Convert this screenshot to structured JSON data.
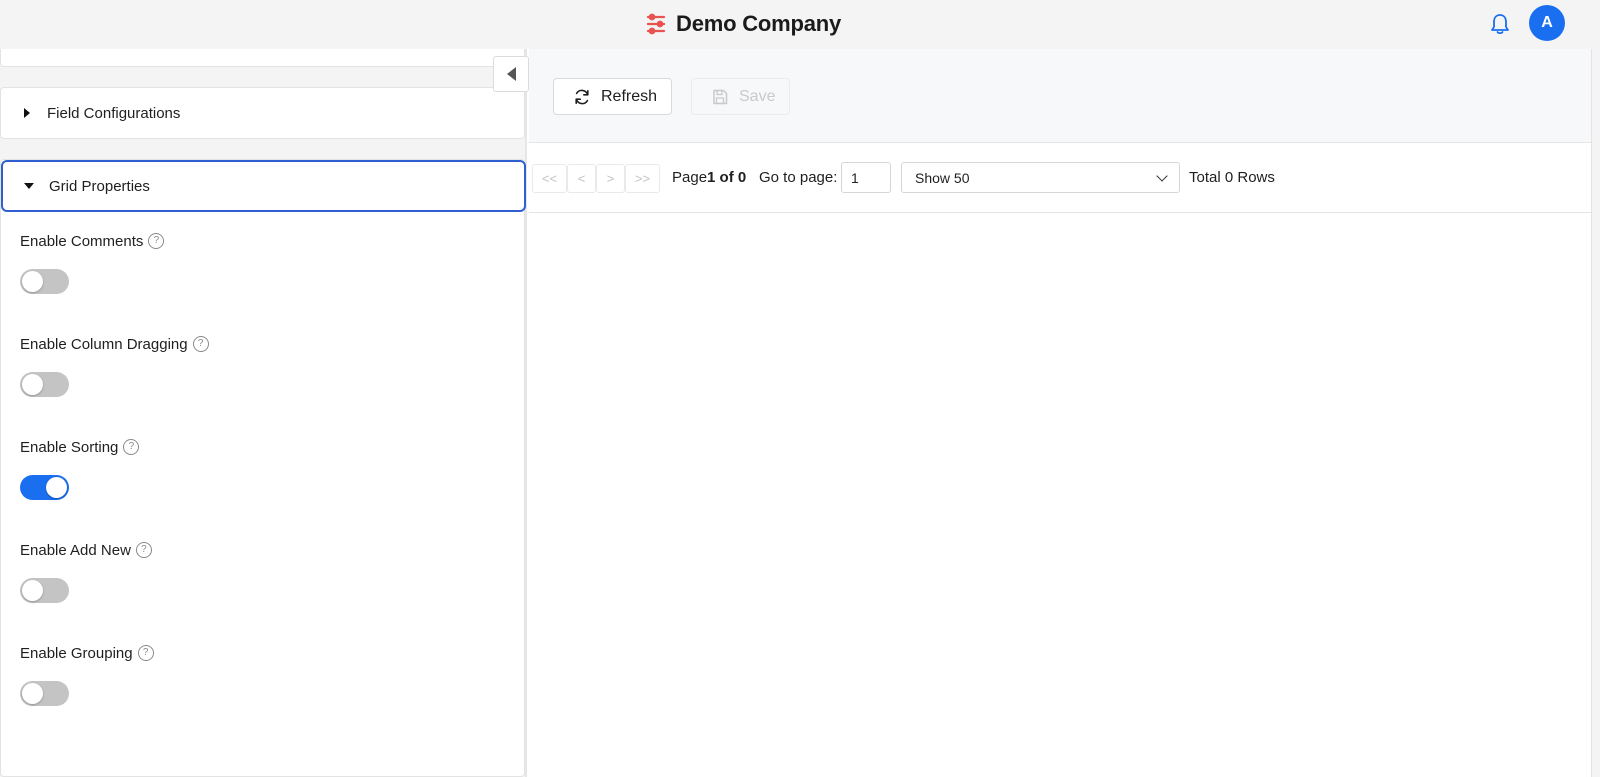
{
  "header": {
    "brand_name": "Demo Company",
    "brand_color": "#e8524f",
    "accent_color": "#1a6ff0",
    "avatar_initial": "A",
    "bell_icon": "bell-icon"
  },
  "sidebar": {
    "sections": [
      {
        "title": "Field Configurations",
        "expanded": false
      },
      {
        "title": "Grid Properties",
        "expanded": true
      }
    ],
    "properties": [
      {
        "label": "Enable Comments",
        "enabled": false
      },
      {
        "label": "Enable Column Dragging",
        "enabled": false
      },
      {
        "label": "Enable Sorting",
        "enabled": true
      },
      {
        "label": "Enable Add New",
        "enabled": false
      },
      {
        "label": "Enable Grouping",
        "enabled": false
      }
    ],
    "help_glyph": "?"
  },
  "toolbar": {
    "refresh_label": "Refresh",
    "save_label": "Save",
    "save_disabled": true
  },
  "pager": {
    "first": "<<",
    "prev": "<",
    "next": ">",
    "last": ">>",
    "page_prefix": "Page",
    "page_current": "1 of 0",
    "goto_label": "Go to page:",
    "goto_value": "1",
    "page_size_selected": "Show 50",
    "total_label": "Total 0 Rows"
  }
}
